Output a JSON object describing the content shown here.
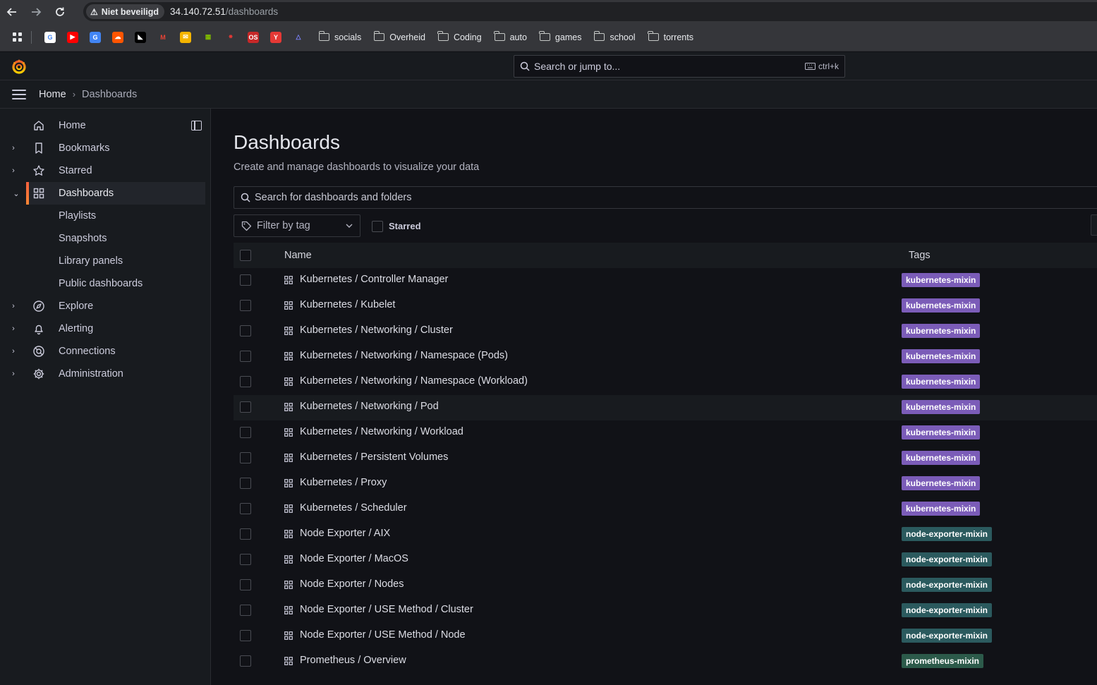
{
  "browser": {
    "security_label": "Niet beveiligd",
    "url_host": "34.140.72.51",
    "url_path": "/dashboards",
    "bookmark_folders": [
      "socials",
      "Overheid",
      "Coding",
      "auto",
      "games",
      "school",
      "torrents"
    ],
    "favicons": [
      {
        "name": "google-favicon",
        "color": "#ffffff",
        "glyph": "G",
        "fg": "#4285f4"
      },
      {
        "name": "youtube-favicon",
        "color": "#ff0000",
        "glyph": "▶",
        "fg": "#ffffff"
      },
      {
        "name": "translate-favicon",
        "color": "#4285f4",
        "glyph": "G",
        "fg": "#ffffff"
      },
      {
        "name": "soundcloud-favicon",
        "color": "#ff5500",
        "glyph": "☁",
        "fg": "#ffffff"
      },
      {
        "name": "amd-favicon",
        "color": "#000000",
        "glyph": "◣",
        "fg": "#ffffff"
      },
      {
        "name": "gmail-favicon",
        "color": "#35363a",
        "glyph": "M",
        "fg": "#ea4335"
      },
      {
        "name": "mail-favicon",
        "color": "#f4b400",
        "glyph": "✉",
        "fg": "#ffffff"
      },
      {
        "name": "microsoft-favicon",
        "color": "#35363a",
        "glyph": "▦",
        "fg": "#7fba00"
      },
      {
        "name": "app-favicon",
        "color": "#35363a",
        "glyph": "⁕",
        "fg": "#e53935"
      },
      {
        "name": "os-favicon",
        "color": "#c62828",
        "glyph": "OS",
        "fg": "#ffffff"
      },
      {
        "name": "y-favicon",
        "color": "#e53935",
        "glyph": "Y",
        "fg": "#ffffff"
      },
      {
        "name": "triangle-favicon",
        "color": "#35363a",
        "glyph": "△",
        "fg": "#7c83fd"
      }
    ]
  },
  "topbar": {
    "search_placeholder": "Search or jump to...",
    "shortcut": "ctrl+k"
  },
  "breadcrumb": {
    "home": "Home",
    "current": "Dashboards"
  },
  "sidebar": {
    "items": [
      {
        "label": "Home",
        "icon": "home-icon",
        "chevron": ""
      },
      {
        "label": "Bookmarks",
        "icon": "bookmark-icon",
        "chevron": "›"
      },
      {
        "label": "Starred",
        "icon": "star-icon",
        "chevron": "›"
      },
      {
        "label": "Dashboards",
        "icon": "apps-icon",
        "chevron": "⌄"
      },
      {
        "label": "Playlists"
      },
      {
        "label": "Snapshots"
      },
      {
        "label": "Library panels"
      },
      {
        "label": "Public dashboards"
      },
      {
        "label": "Explore",
        "icon": "compass-icon",
        "chevron": "›"
      },
      {
        "label": "Alerting",
        "icon": "bell-icon",
        "chevron": "›"
      },
      {
        "label": "Connections",
        "icon": "connections-icon",
        "chevron": "›"
      },
      {
        "label": "Administration",
        "icon": "cog-icon",
        "chevron": "›"
      }
    ]
  },
  "main": {
    "title": "Dashboards",
    "subtitle": "Create and manage dashboards to visualize your data",
    "search_placeholder": "Search for dashboards and folders",
    "filter_label": "Filter by tag",
    "starred_label": "Starred",
    "columns": {
      "name": "Name",
      "tags": "Tags"
    },
    "tag_colors": {
      "kubernetes-mixin": "#7b5cb8",
      "node-exporter-mixin": "#2b5a5e",
      "prometheus-mixin": "#2c5a4a"
    },
    "rows": [
      {
        "title": "Kubernetes / Controller Manager",
        "tag": "kubernetes-mixin"
      },
      {
        "title": "Kubernetes / Kubelet",
        "tag": "kubernetes-mixin"
      },
      {
        "title": "Kubernetes / Networking / Cluster",
        "tag": "kubernetes-mixin"
      },
      {
        "title": "Kubernetes / Networking / Namespace (Pods)",
        "tag": "kubernetes-mixin"
      },
      {
        "title": "Kubernetes / Networking / Namespace (Workload)",
        "tag": "kubernetes-mixin"
      },
      {
        "title": "Kubernetes / Networking / Pod",
        "tag": "kubernetes-mixin"
      },
      {
        "title": "Kubernetes / Networking / Workload",
        "tag": "kubernetes-mixin"
      },
      {
        "title": "Kubernetes / Persistent Volumes",
        "tag": "kubernetes-mixin"
      },
      {
        "title": "Kubernetes / Proxy",
        "tag": "kubernetes-mixin"
      },
      {
        "title": "Kubernetes / Scheduler",
        "tag": "kubernetes-mixin"
      },
      {
        "title": "Node Exporter / AIX",
        "tag": "node-exporter-mixin"
      },
      {
        "title": "Node Exporter / MacOS",
        "tag": "node-exporter-mixin"
      },
      {
        "title": "Node Exporter / Nodes",
        "tag": "node-exporter-mixin"
      },
      {
        "title": "Node Exporter / USE Method / Cluster",
        "tag": "node-exporter-mixin"
      },
      {
        "title": "Node Exporter / USE Method / Node",
        "tag": "node-exporter-mixin"
      },
      {
        "title": "Prometheus / Overview",
        "tag": "prometheus-mixin"
      }
    ],
    "hovered_row": 5
  }
}
